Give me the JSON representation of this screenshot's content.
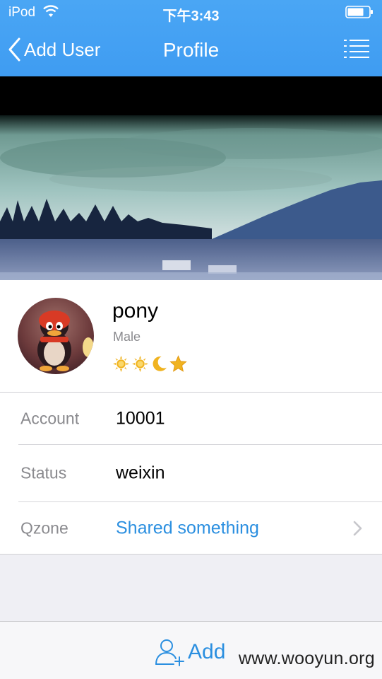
{
  "status_bar": {
    "carrier": "iPod",
    "time": "下午3:43"
  },
  "nav": {
    "back_label": "Add User",
    "title": "Profile"
  },
  "profile": {
    "name": "pony",
    "gender": "Male",
    "level_icons": [
      "sun-icon",
      "sun-icon",
      "moon-icon",
      "star-icon"
    ]
  },
  "info": [
    {
      "label": "Account",
      "value": "10001"
    },
    {
      "label": "Status",
      "value": "weixin"
    },
    {
      "label": "Qzone",
      "value": "Shared something"
    }
  ],
  "bottom": {
    "add_label": "Add"
  },
  "watermark": "www.wooyun.org",
  "colors": {
    "nav_blue": "#4aa6f4",
    "link_blue": "#2b8fe0"
  }
}
